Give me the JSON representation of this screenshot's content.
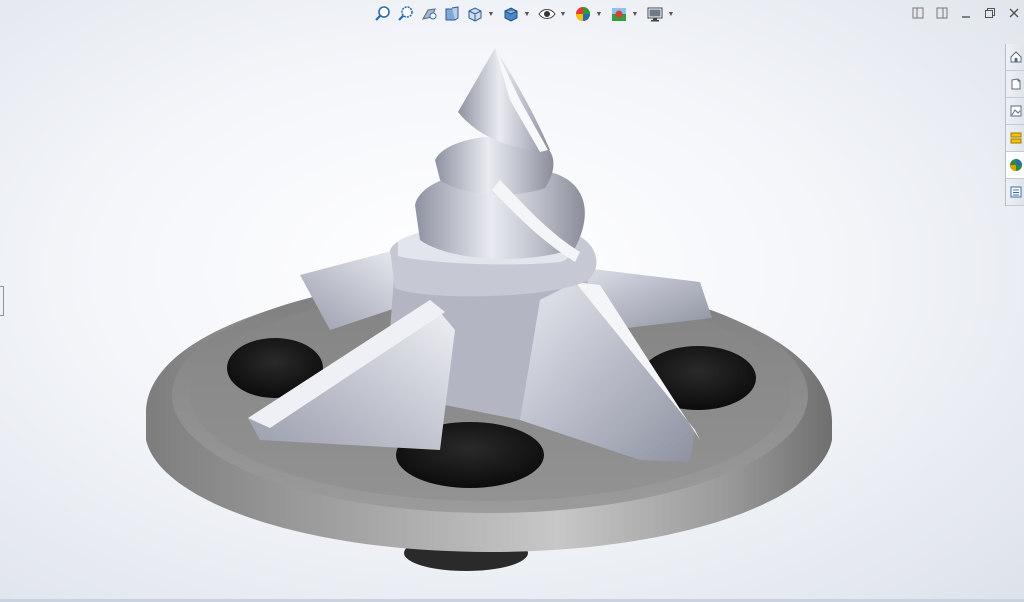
{
  "toolbar": {
    "buttons": [
      {
        "name": "zoom-to-fit-icon",
        "has_dropdown": false
      },
      {
        "name": "zoom-to-area-icon",
        "has_dropdown": false
      },
      {
        "name": "previous-view-icon",
        "has_dropdown": false
      },
      {
        "name": "section-view-icon",
        "has_dropdown": false
      },
      {
        "name": "view-orientation-icon",
        "has_dropdown": true
      },
      {
        "name": "display-style-icon",
        "has_dropdown": true
      },
      {
        "name": "hide-show-items-icon",
        "has_dropdown": true
      },
      {
        "name": "edit-appearance-icon",
        "has_dropdown": true
      },
      {
        "name": "apply-scene-icon",
        "has_dropdown": true
      },
      {
        "name": "view-settings-icon",
        "has_dropdown": true
      }
    ]
  },
  "window_controls": [
    "tile-left-icon",
    "tile-right-icon",
    "minimize-icon",
    "restore-icon",
    "close-icon"
  ],
  "task_pane_tabs": [
    {
      "name": "solidworks-resources-icon",
      "color": "#6a7a8c"
    },
    {
      "name": "design-library-icon",
      "color": "#6a7a8c"
    },
    {
      "name": "file-explorer-icon",
      "color": "#6a7a8c"
    },
    {
      "name": "view-palette-icon",
      "color": "#e0a000"
    },
    {
      "name": "appearances-scenes-icon",
      "color": "#2e8b3e"
    },
    {
      "name": "custom-properties-icon",
      "color": "#3a6ea8"
    }
  ],
  "colors": {
    "part_silver": "#c9ccd6",
    "base_plate": "#8d8d8d",
    "hole": "#151515",
    "background": "#f4f6fa",
    "toolbar_blue": "#2b6cb0"
  }
}
